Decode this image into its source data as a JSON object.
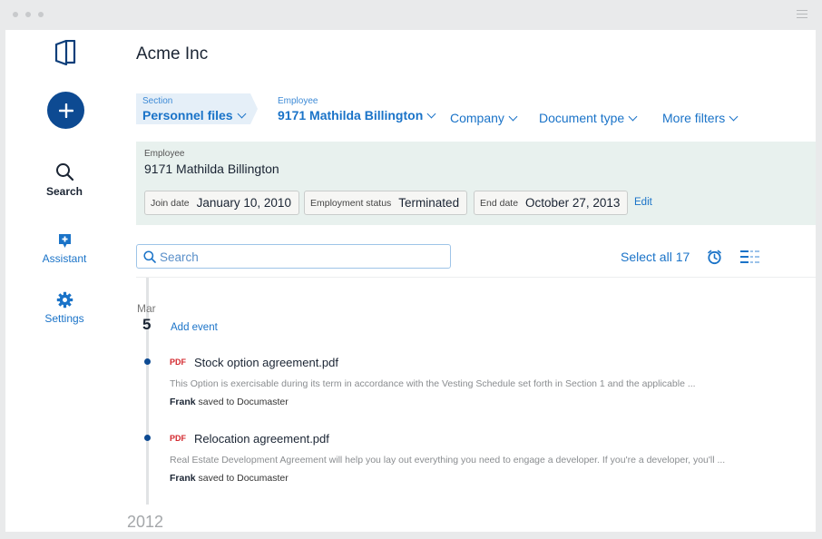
{
  "app": {
    "title": "Acme Inc"
  },
  "sidebar": {
    "items": [
      {
        "label": "Search",
        "icon": "search-icon"
      },
      {
        "label": "Assistant",
        "icon": "assistant-icon"
      },
      {
        "label": "Settings",
        "icon": "gear-icon"
      }
    ]
  },
  "filters": {
    "section": {
      "label": "Section",
      "value": "Personnel files"
    },
    "employee": {
      "label": "Employee",
      "value": "9171 Mathilda Billington"
    },
    "company": {
      "value": "Company"
    },
    "document_type": {
      "value": "Document type"
    },
    "more": {
      "value": "More filters"
    }
  },
  "employee_panel": {
    "label": "Employee",
    "name": "9171 Mathilda Billington",
    "fields": [
      {
        "label": "Join date",
        "value": "January 10, 2010"
      },
      {
        "label": "Employment status",
        "value": "Terminated"
      },
      {
        "label": "End date",
        "value": "October 27, 2013"
      }
    ],
    "edit_label": "Edit"
  },
  "search": {
    "placeholder": "Search"
  },
  "select_all_label": "Select all 17",
  "timeline": {
    "month": "Mar",
    "day": "5",
    "add_event_label": "Add event",
    "documents": [
      {
        "type": "PDF",
        "name": "Stock option agreement.pdf",
        "excerpt": "This Option is exercisable during its term in accordance with the Vesting Schedule set forth in Section 1 and the applicable ...",
        "saved_by": "Frank",
        "saved_text": "saved to Documaster"
      },
      {
        "type": "PDF",
        "name": "Relocation agreement.pdf",
        "excerpt": "Real Estate Development Agreement will help you lay out everything you need to engage a developer. If you're a developer, you'll ...",
        "saved_by": "Frank",
        "saved_text": "saved to Documaster"
      }
    ],
    "year": "2012"
  },
  "colors": {
    "accent": "#1a73c8",
    "brand": "#0d4a92",
    "panel": "#e8f1ee",
    "pdf": "#d3282e"
  }
}
